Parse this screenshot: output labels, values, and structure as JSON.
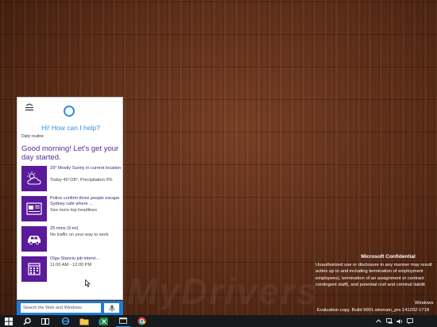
{
  "colors": {
    "accent": "#2f8fe0",
    "tile": "#5a1a9a",
    "headline": "#5b2a91",
    "searchbar": "#1e7bd8",
    "taskbar": "#17191c"
  },
  "cortana": {
    "prompt": "Hi! How can I help?",
    "section_label": "Daily routine",
    "headline": "Good morning! Let's get your day started.",
    "cards": [
      {
        "icon": "weather-cloud-icon",
        "title": "29° Mostly Sunny in current location",
        "subtitle": "Today 46°/28°, Precipitation 0%"
      },
      {
        "icon": "news-icon",
        "title": "Police confirm three people escape Sydney cafe where ...",
        "subtitle": "See more top headlines"
      },
      {
        "icon": "car-icon",
        "title": "25 mins (9 mi)",
        "subtitle": "No traffic on your way to work"
      },
      {
        "icon": "calendar-icon",
        "title": "Olga Stanciu job intervi...",
        "subtitle": "11:00 AM - 12:00 PM"
      }
    ]
  },
  "search": {
    "placeholder": "Search the Web and Windows"
  },
  "desktop": {
    "watermark": "MyDrivers",
    "confidential_title": "Microsoft Confidential",
    "confidential_lines": [
      "Unauthorized use or disclosure in any manner may result",
      "action up to and including termination of employment",
      "employees), termination of an assignment or contract",
      "contingent staff), and potential civil and criminal liabilit"
    ],
    "os_name": "Windows",
    "eval_text": "Evaluation copy. Build 9901.winmain_prs.141202-1718"
  },
  "taskbar": {
    "icons": [
      "windows-start-icon",
      "search-icon",
      "task-view-icon",
      "internet-explorer-icon",
      "file-explorer-icon",
      "store-icon",
      "excel-icon",
      "window-icon",
      "chrome-icon"
    ],
    "tray_icons": [
      "chevron-up-icon",
      "network-icon",
      "volume-icon",
      "notifications-icon"
    ]
  }
}
